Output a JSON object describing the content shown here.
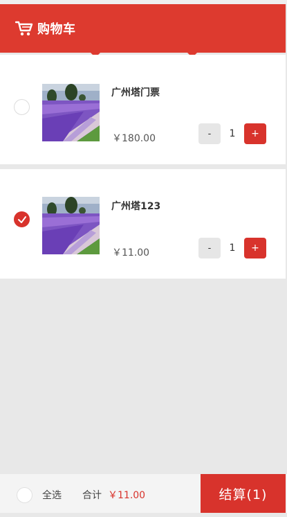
{
  "header": {
    "title": "购物车"
  },
  "items": [
    {
      "name": "广州塔门票",
      "price": "￥180.00",
      "quantity": "1",
      "checked": false,
      "minus_label": "-",
      "plus_label": "+"
    },
    {
      "name": "广州塔123",
      "price": "￥11.00",
      "quantity": "1",
      "checked": true,
      "minus_label": "-",
      "plus_label": "+"
    }
  ],
  "footer": {
    "select_all_label": "全选",
    "total_label": "合计",
    "total_value": "￥11.00",
    "checkout_label": "结算(1)"
  },
  "colors": {
    "accent": "#dd3a2f",
    "button_red": "#d8332c",
    "background": "#e8e8e8"
  },
  "icons": {
    "header": "shopping-cart-icon",
    "checked": "checkmark-icon"
  }
}
